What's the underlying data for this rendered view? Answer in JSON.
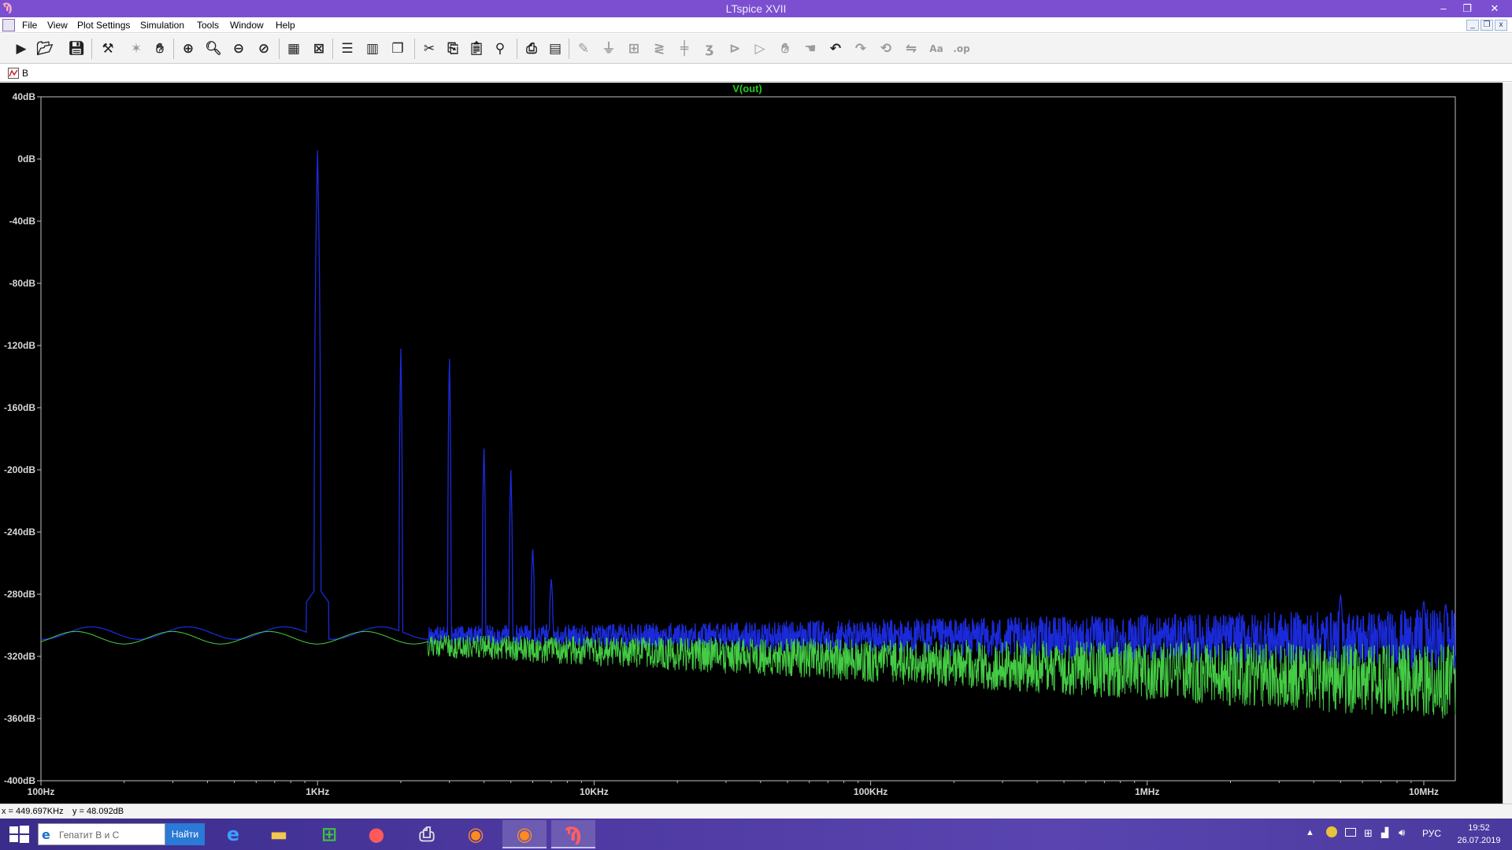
{
  "window": {
    "title": "LTspice XVII",
    "controls": [
      "–",
      "❐",
      "✕"
    ]
  },
  "menu": {
    "items": [
      "File",
      "View",
      "Plot Settings",
      "Simulation",
      "Tools",
      "Window",
      "Help"
    ],
    "mdi_controls": [
      "_",
      "❐",
      "x"
    ]
  },
  "toolbar": {
    "icons": [
      "run-icon",
      "open-icon",
      "save-icon",
      "control-panel-icon",
      "halt-icon",
      "pan-hand-icon",
      "zoom-in-icon",
      "zoom-area-icon",
      "zoom-out-icon",
      "zoom-fit-icon",
      "autorange-icon",
      "fft-icon",
      "tile-horizontal-icon",
      "tile-vertical-icon",
      "cascade-icon",
      "cut-icon",
      "copy-icon",
      "paste-icon",
      "find-icon",
      "print-icon",
      "print-setup-icon",
      "draw-wire-icon",
      "ground-icon",
      "label-icon",
      "resistor-icon",
      "capacitor-icon",
      "inductor-icon",
      "diode-icon",
      "component-icon",
      "move-icon",
      "drag-icon",
      "undo-icon",
      "redo-icon",
      "rotate-icon",
      "mirror-icon",
      "text-icon",
      "spice-directive-icon"
    ]
  },
  "tab": {
    "label": "B"
  },
  "plot": {
    "background": "#000000",
    "trace_label": "V(out)",
    "trace_label_color": "#22cc22"
  },
  "chart_data": {
    "type": "line",
    "title": "V(out)",
    "xscale": "log",
    "xlim": [
      100,
      13000000
    ],
    "ylim": [
      -400,
      40
    ],
    "x_tick_labels": [
      "100Hz",
      "1KHz",
      "10KHz",
      "100KHz",
      "1MHz",
      "10MHz"
    ],
    "x_ticks": [
      100,
      1000,
      10000,
      100000,
      1000000,
      10000000
    ],
    "y_tick_labels": [
      "40dB",
      "0dB",
      "-40dB",
      "-80dB",
      "-120dB",
      "-160dB",
      "-200dB",
      "-240dB",
      "-280dB",
      "-320dB",
      "-360dB",
      "-400dB"
    ],
    "y_ticks": [
      40,
      0,
      -40,
      -80,
      -120,
      -160,
      -200,
      -240,
      -280,
      -320,
      -360,
      -400
    ],
    "grid": false,
    "series": [
      {
        "color": "#1a2ad8",
        "noise_floor_db": -305,
        "peaks": [
          {
            "x": 1000,
            "y": 6
          },
          {
            "x": 2000,
            "y": -120
          },
          {
            "x": 3000,
            "y": -126
          },
          {
            "x": 4000,
            "y": -184
          },
          {
            "x": 5000,
            "y": -200
          },
          {
            "x": 6000,
            "y": -250
          },
          {
            "x": 7000,
            "y": -270
          },
          {
            "x": 5000000,
            "y": -280
          },
          {
            "x": 10000000,
            "y": -284
          },
          {
            "x": 12000000,
            "y": -286
          }
        ]
      },
      {
        "color": "#44cc44",
        "noise_floor_db": -308,
        "peaks": []
      }
    ]
  },
  "statusbar": {
    "x_readout": "x = 449.697KHz",
    "y_readout": "y = 48.092dB"
  },
  "taskbar": {
    "search_placeholder": "Гепатит В и С",
    "search_button": "Найти",
    "apps": [
      "internet-explorer-icon",
      "file-explorer-icon",
      "store-icon",
      "paint-icon",
      "printer-app-icon",
      "firefox-icon",
      "firefox-icon-2",
      "ltspice-icon"
    ],
    "language": "РУС",
    "time": "19:52",
    "date": "26.07.2019"
  }
}
